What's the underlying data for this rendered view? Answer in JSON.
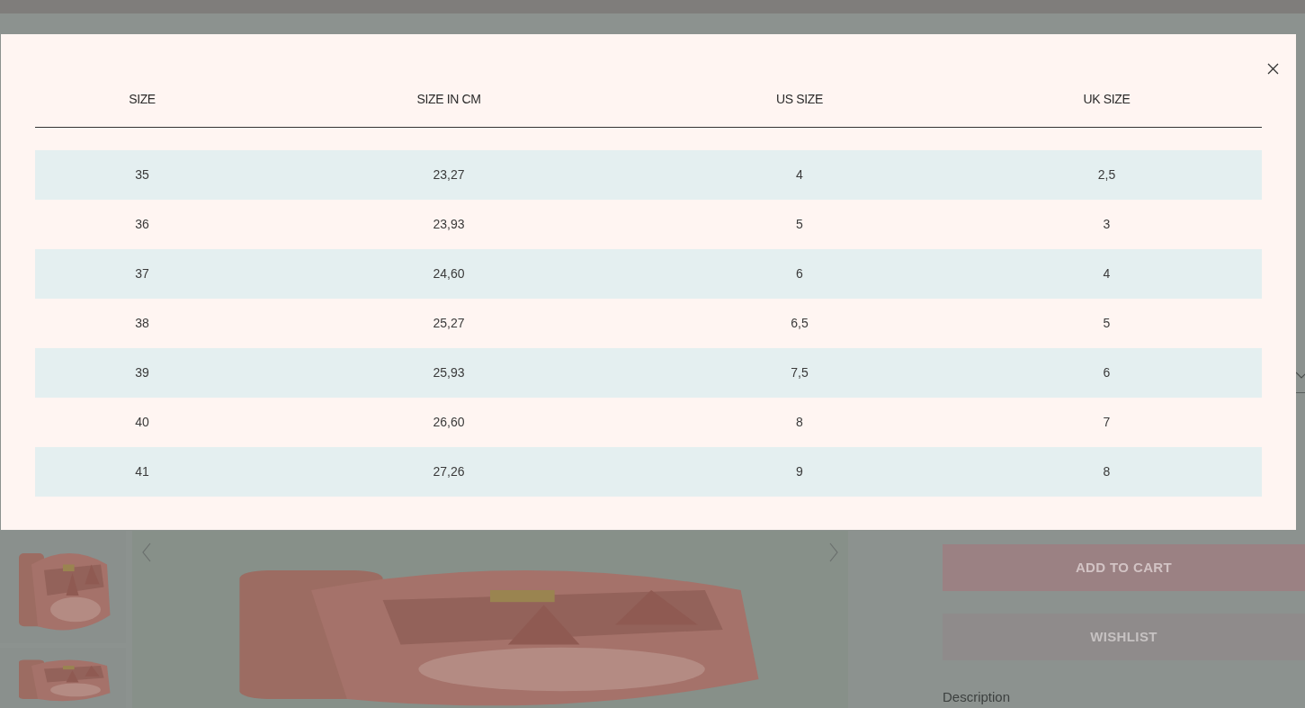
{
  "product_page": {
    "add_to_cart": "ADD TO CART",
    "wishlist": "WISHLIST",
    "description_label": "Description"
  },
  "size_chart_modal": {
    "columns": [
      "SIZE",
      "SIZE IN CM",
      "US SIZE",
      "UK SIZE"
    ],
    "rows": [
      [
        "35",
        "23,27",
        "4",
        "2,5"
      ],
      [
        "36",
        "23,93",
        "5",
        "3"
      ],
      [
        "37",
        "24,60",
        "6",
        "4"
      ],
      [
        "38",
        "25,27",
        "6,5",
        "5"
      ],
      [
        "39",
        "25,93",
        "7,5",
        "6"
      ],
      [
        "40",
        "26,60",
        "8",
        "7"
      ],
      [
        "41",
        "27,26",
        "9",
        "8"
      ]
    ]
  }
}
